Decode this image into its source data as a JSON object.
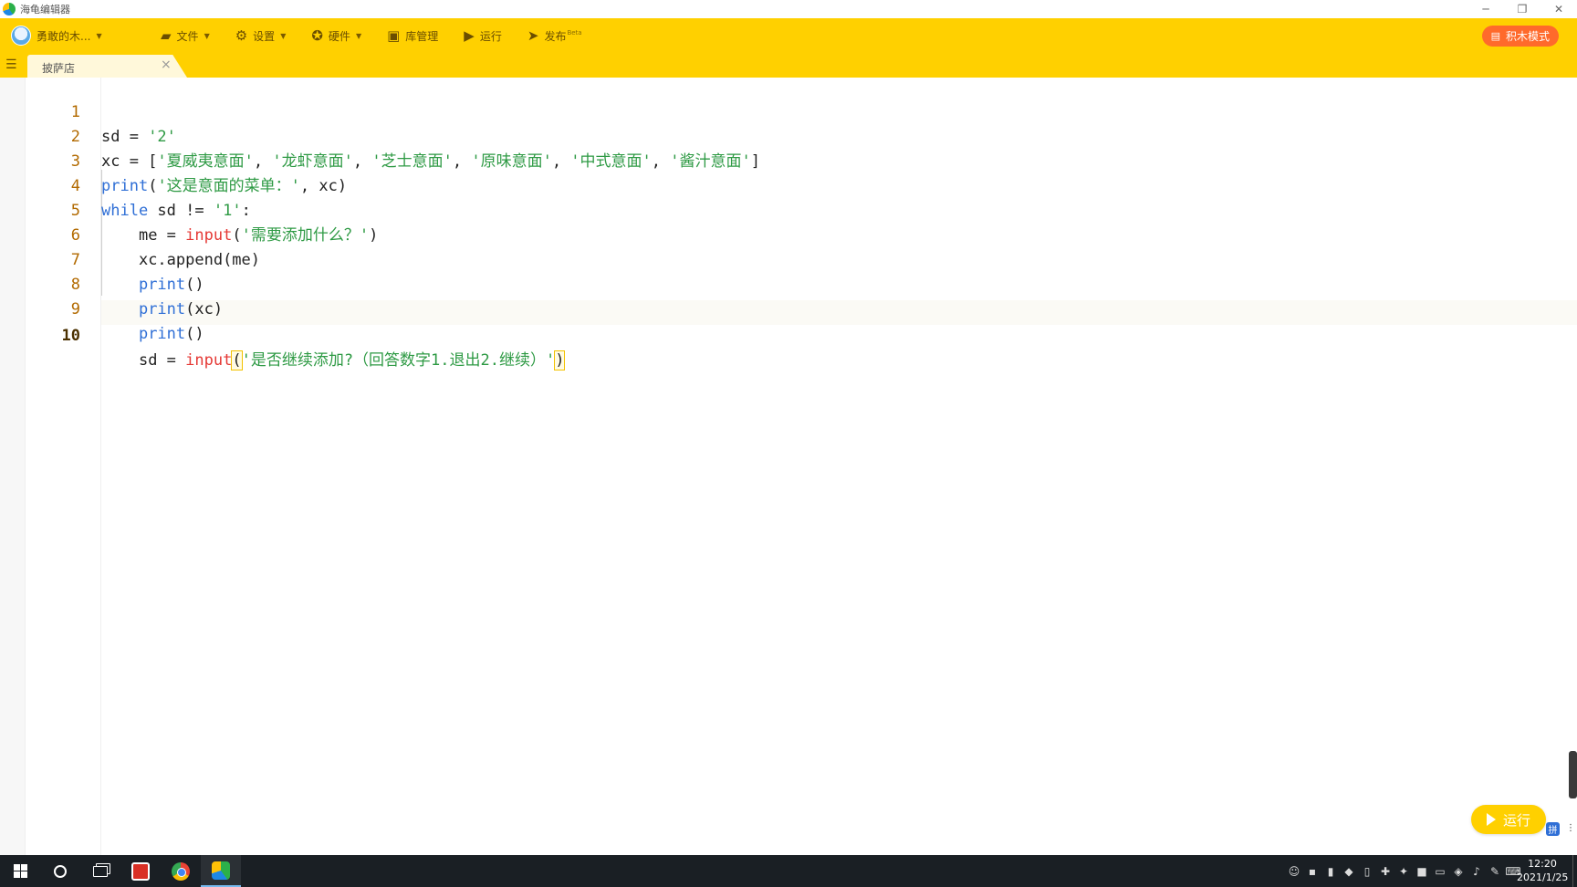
{
  "window": {
    "title": "海龟编辑器",
    "controls": [
      "─",
      "❐",
      "✕"
    ]
  },
  "toolbar": {
    "user_name": "勇敢的木...",
    "file": "文件",
    "settings": "设置",
    "hardware": "硬件",
    "library": "库管理",
    "run": "运行",
    "publish": "发布",
    "publish_sup": "Beta",
    "mode_button": "积木模式"
  },
  "tab": {
    "label": "披萨店",
    "close": "×"
  },
  "editor": {
    "active_line": 10,
    "lines": [
      {
        "num": "1"
      },
      {
        "num": "2"
      },
      {
        "num": "3"
      },
      {
        "num": "4"
      },
      {
        "num": "5"
      },
      {
        "num": "6"
      },
      {
        "num": "7"
      },
      {
        "num": "8"
      },
      {
        "num": "9"
      },
      {
        "num": "10"
      }
    ],
    "tokens": {
      "l1": {
        "a": "sd = ",
        "b": "'2'"
      },
      "l2": {
        "a": "xc = [",
        "s1": "'夏威夷意面'",
        "s2": "'龙虾意面'",
        "s3": "'芝士意面'",
        "s4": "'原味意面'",
        "s5": "'中式意面'",
        "s6": "'酱汁意面'",
        "sep": ", ",
        "end": "]"
      },
      "l3": {
        "fn": "print",
        "open": "(",
        "s": "'这是意面的菜单：'",
        "rest": ", xc)"
      },
      "l4": {
        "kw": "while",
        "a": " sd != ",
        "s": "'1'",
        "b": ":"
      },
      "l5": {
        "indent": "    ",
        "a": "me = ",
        "fn": "input",
        "open": "(",
        "s": "'需要添加什么？'",
        "close": ")"
      },
      "l6": {
        "indent": "    ",
        "a": "xc.append(me)"
      },
      "l7": {
        "indent": "    ",
        "fn": "print",
        "rest": "()"
      },
      "l8": {
        "indent": "    ",
        "fn": "print",
        "rest": "(xc)"
      },
      "l9": {
        "indent": "    ",
        "fn": "print",
        "rest": "()"
      },
      "l10": {
        "indent": "    ",
        "a": "sd = ",
        "fn": "input",
        "open": "(",
        "s": "'是否继续添加?（回答数字1.退出2.继续）'",
        "close": ")"
      }
    }
  },
  "run_fab": "运行",
  "taskbar": {
    "time": "12:20",
    "date": "2021/1/25"
  },
  "colors": {
    "accent": "#ffd000",
    "mode_button": "#ff6a2b",
    "keyword": "#2f6fd6",
    "builtin_red": "#e53935",
    "string": "#2e9a44",
    "line_number": "#b26a00"
  }
}
